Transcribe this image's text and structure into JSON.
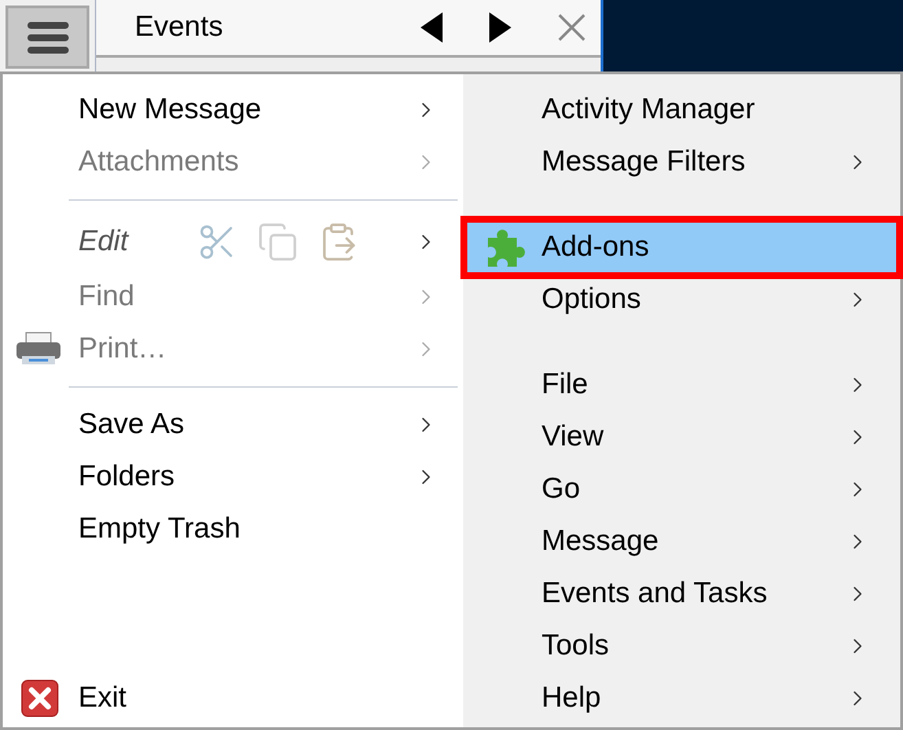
{
  "tab": {
    "label": "Events"
  },
  "left_menu": [
    {
      "kind": "item",
      "label": "New Message",
      "disabled": false,
      "submenu": true
    },
    {
      "kind": "item",
      "label": "Attachments",
      "disabled": true,
      "submenu": true
    },
    {
      "kind": "separator"
    },
    {
      "kind": "edit",
      "label": "Edit",
      "disabled": false,
      "submenu": true
    },
    {
      "kind": "item",
      "label": "Find",
      "disabled": true,
      "submenu": true
    },
    {
      "kind": "print",
      "label": "Print…",
      "disabled": true,
      "submenu": true
    },
    {
      "kind": "separator"
    },
    {
      "kind": "item",
      "label": "Save As",
      "disabled": false,
      "submenu": true
    },
    {
      "kind": "item",
      "label": "Folders",
      "disabled": false,
      "submenu": true
    },
    {
      "kind": "item",
      "label": "Empty Trash",
      "disabled": false,
      "submenu": false
    },
    {
      "kind": "spacer"
    },
    {
      "kind": "exit",
      "label": "Exit",
      "disabled": false,
      "submenu": false
    }
  ],
  "right_menu": [
    {
      "kind": "item",
      "label": "Activity Manager",
      "selected": false,
      "submenu": false
    },
    {
      "kind": "item",
      "label": "Message Filters",
      "selected": false,
      "submenu": true
    },
    {
      "kind": "gap"
    },
    {
      "kind": "addon",
      "label": "Add-ons",
      "selected": true,
      "submenu": false
    },
    {
      "kind": "item",
      "label": "Options",
      "selected": false,
      "submenu": true
    },
    {
      "kind": "gap"
    },
    {
      "kind": "item",
      "label": "File",
      "selected": false,
      "submenu": true
    },
    {
      "kind": "item",
      "label": "View",
      "selected": false,
      "submenu": true
    },
    {
      "kind": "item",
      "label": "Go",
      "selected": false,
      "submenu": true
    },
    {
      "kind": "item",
      "label": "Message",
      "selected": false,
      "submenu": true
    },
    {
      "kind": "item",
      "label": "Events and Tasks",
      "selected": false,
      "submenu": true
    },
    {
      "kind": "item",
      "label": "Tools",
      "selected": false,
      "submenu": true
    },
    {
      "kind": "item",
      "label": "Help",
      "selected": false,
      "submenu": true
    }
  ]
}
